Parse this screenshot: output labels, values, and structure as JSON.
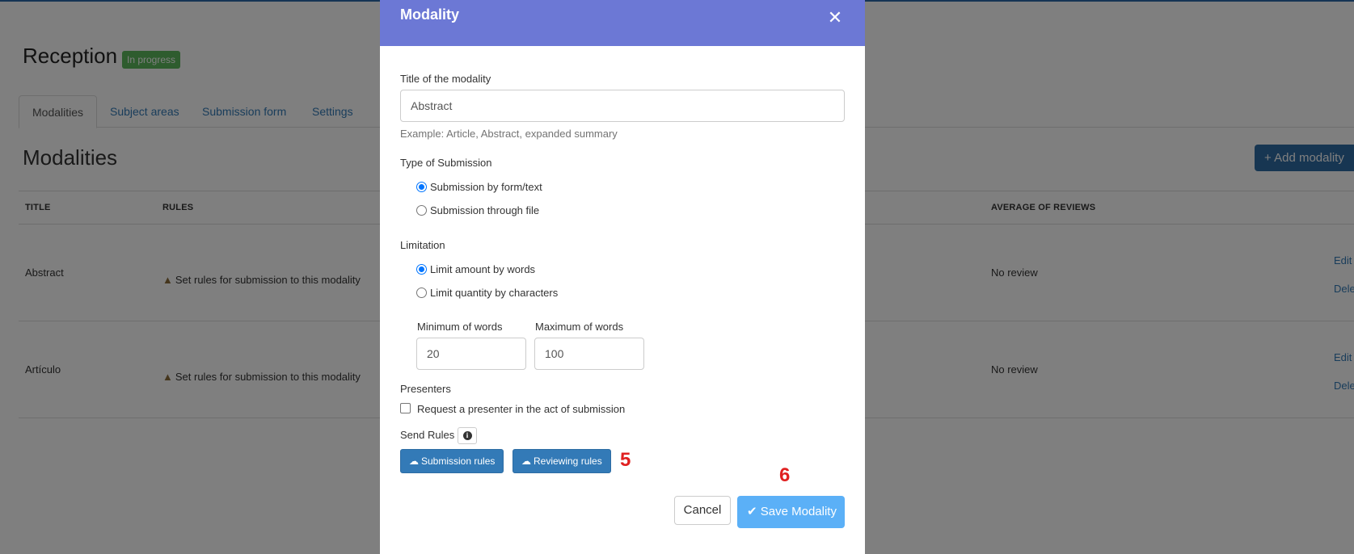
{
  "background": {
    "page_title": "Reception",
    "status_badge": "In progress",
    "tabs": [
      {
        "label": "Modalities",
        "active": true
      },
      {
        "label": "Subject areas"
      },
      {
        "label": "Submission form"
      },
      {
        "label": "Settings"
      }
    ],
    "section_title": "Modalities",
    "add_button": "Add modality",
    "table": {
      "columns": [
        "TITLE",
        "RULES",
        "AVERAGE OF REVIEWS"
      ],
      "rows": [
        {
          "title": "Abstract",
          "rules": "Set rules for submission to this modality",
          "average": "No review",
          "edit": "Edit",
          "delete": "Dele"
        },
        {
          "title": "Artículo",
          "rules": "Set rules for submission to this modality",
          "average": "No review",
          "edit": "Edit",
          "delete": "Dele"
        }
      ]
    }
  },
  "modal": {
    "title": "Modality",
    "close_icon": "close-icon",
    "title_field": {
      "label": "Title of the modality",
      "value": "Abstract",
      "help": "Example: Article, Abstract, expanded summary"
    },
    "submission_type": {
      "label": "Type of Submission",
      "options": [
        {
          "label": "Submission by form/text",
          "checked": true
        },
        {
          "label": "Submission through file",
          "checked": false
        }
      ]
    },
    "limitation": {
      "label": "Limitation",
      "options": [
        {
          "label": "Limit amount by words",
          "checked": true
        },
        {
          "label": "Limit quantity by characters",
          "checked": false
        }
      ],
      "min_label": "Minimum of words",
      "min_value": "20",
      "max_label": "Maximum of words",
      "max_value": "100"
    },
    "presenters": {
      "label": "Presenters",
      "checkbox_label": "Request a presenter in the act of submission",
      "checked": false
    },
    "send_rules": {
      "label": "Send Rules",
      "info_icon": "info-icon",
      "submission_button": "Submission rules",
      "reviewing_button": "Reviewing rules"
    },
    "cancel_button": "Cancel",
    "save_button": "Save Modality"
  },
  "annotations": {
    "marker_5": "5",
    "marker_6": "6"
  },
  "colors": {
    "modal_header": "#6c78d5",
    "primary": "#337ab7",
    "save": "#5bb0f7",
    "badge": "#5cb85c",
    "marker": "#e02020"
  }
}
